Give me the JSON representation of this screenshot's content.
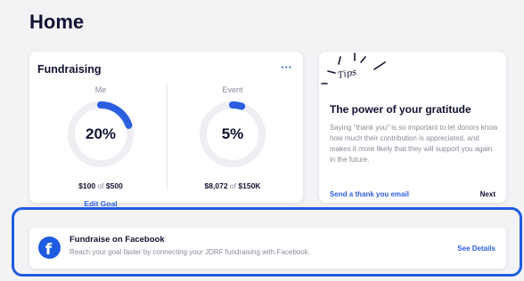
{
  "page": {
    "title": "Home"
  },
  "fundraising": {
    "title": "Fundraising",
    "more_label": "···",
    "me": {
      "label": "Me",
      "percent_label": "20%",
      "progress": 0.2,
      "raised": "$100",
      "of_text": "of",
      "goal": "$500",
      "edit_label": "Edit Goal"
    },
    "event": {
      "label": "Event",
      "percent_label": "5%",
      "progress": 0.05,
      "raised": "$8,072",
      "of_text": "of",
      "goal": "$150K"
    }
  },
  "tips": {
    "badge": "Tips",
    "heading": "The power of your gratitude",
    "body": "Saying \"thank you\" is so important to let donors know how much their contribution is appreciated, and makes it more likely that they will support you again in the future.",
    "link_label": "Send a thank you email",
    "next_label": "Next"
  },
  "facebook": {
    "icon": "facebook-icon",
    "icon_glyph": "f",
    "title": "Fundraise on Facebook",
    "description": "Reach your goal faster by connecting your JDRF fundraising with Facebook.",
    "details_label": "See Details"
  },
  "colors": {
    "accent": "#2b5fe0",
    "ring_track": "#eeeef3",
    "highlight": "#1f5be0",
    "text_dark": "#111133",
    "text_muted": "#8a8a9a"
  }
}
